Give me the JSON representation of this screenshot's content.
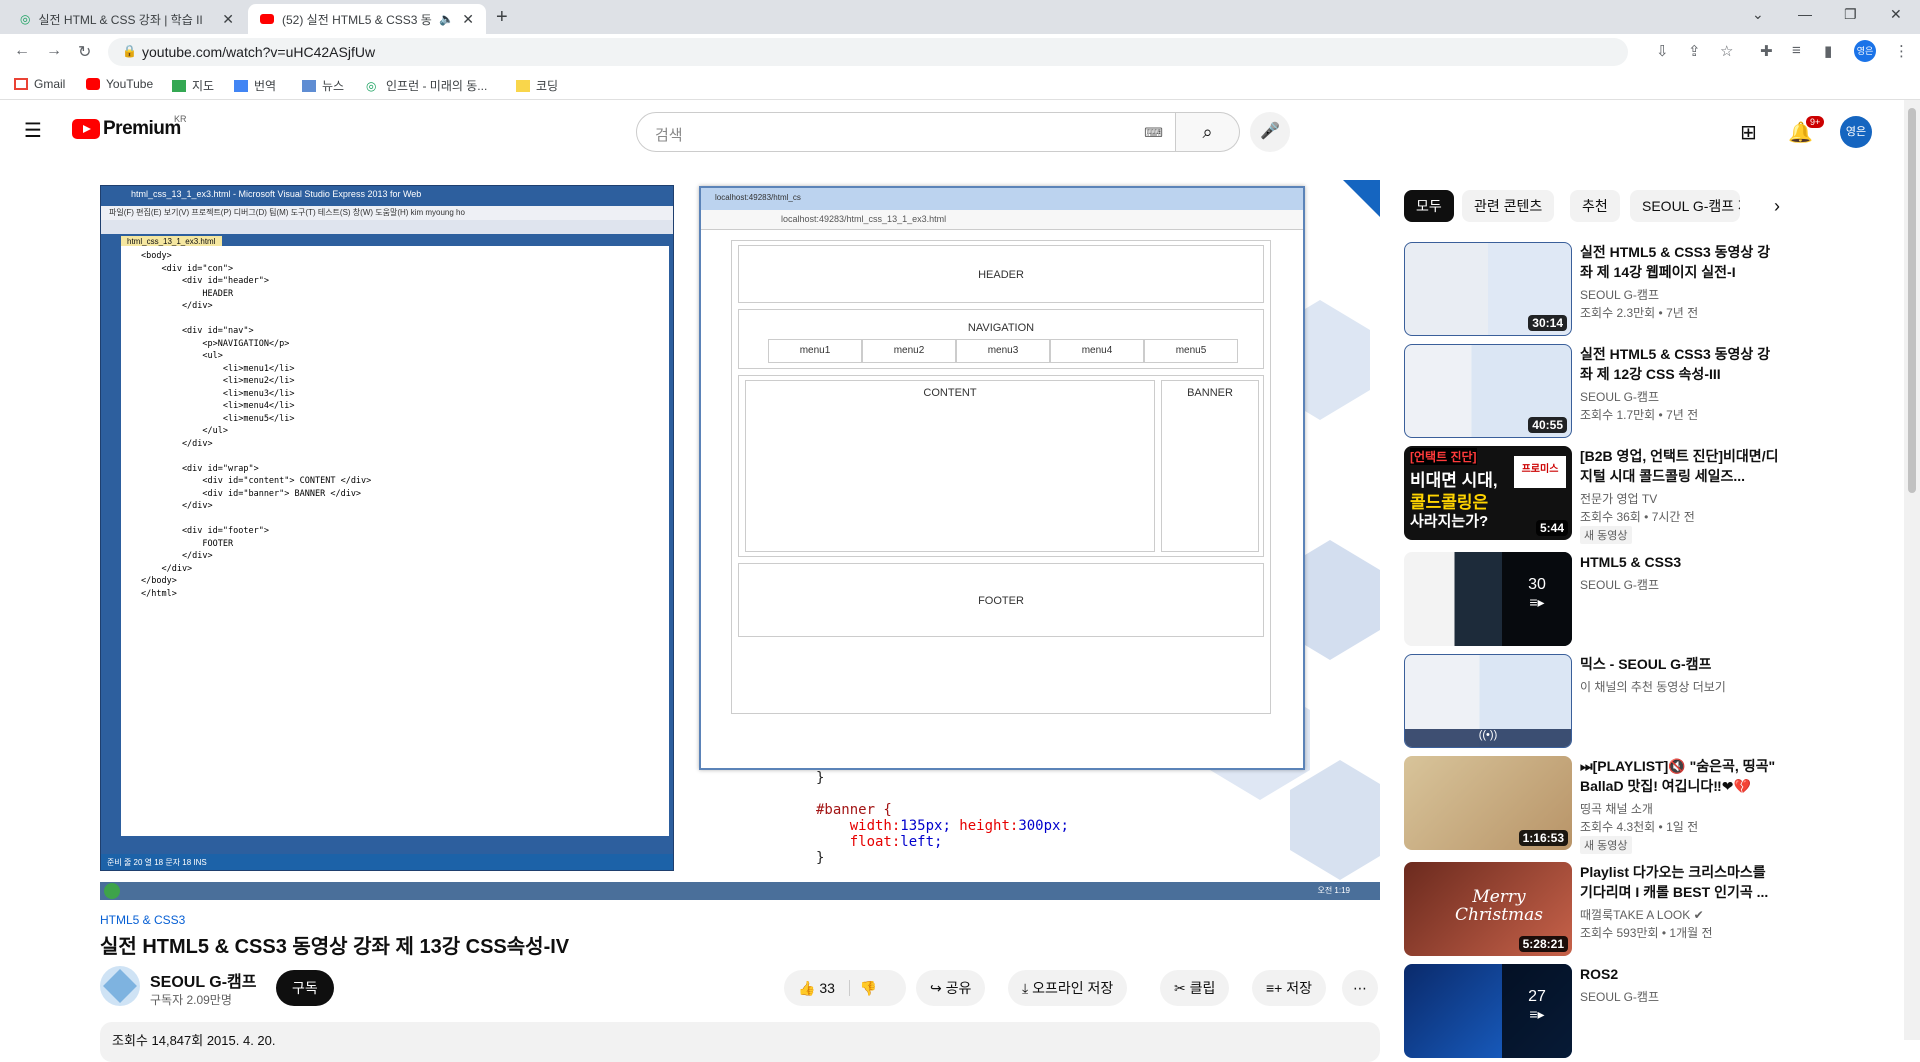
{
  "browser": {
    "tabs": [
      {
        "title": "실전 HTML & CSS 강좌 | 학습 II"
      },
      {
        "title": "(52) 실전 HTML5 & CSS3 동"
      }
    ],
    "url": "youtube.com/watch?v=uHC42ASjfUw",
    "profile_label": "영은",
    "bookmarks": [
      "Gmail",
      "YouTube",
      "지도",
      "번역",
      "뉴스",
      "인프런 - 미래의 동...",
      "코딩"
    ]
  },
  "yt": {
    "logo_text": "Premium",
    "region": "KR",
    "search_placeholder": "검색",
    "notif_badge": "9+",
    "avatar_label": "영은"
  },
  "video": {
    "vs_title": "html_css_13_1_ex3.html - Microsoft Visual Studio Express 2013 for Web",
    "vs_menu": "파일(F)   편집(E)   보기(V)   프로젝트(P)   디버그(D)   팀(M)   도구(T)   테스트(S)   창(W)   도움말(H)        kim myoung ho",
    "vs_file_tab": "html_css_13_1_ex3.html",
    "vs_status": "준비                                                                                줄 20          열 18          문자 18          INS",
    "code_lines": [
      "<body>",
      "    <div id=\"con\">",
      "        <div id=\"header\">",
      "            HEADER",
      "        </div>",
      "",
      "        <div id=\"nav\">",
      "            <p>NAVIGATION</p>",
      "            <ul>",
      "                <li>menu1</li>",
      "                <li>menu2</li>",
      "                <li>menu3</li>",
      "                <li>menu4</li>",
      "                <li>menu5</li>",
      "            </ul>",
      "        </div>",
      "",
      "        <div id=\"wrap\">",
      "            <div id=\"content\"> CONTENT </div>",
      "            <div id=\"banner\"> BANNER </div>",
      "        </div>",
      "",
      "        <div id=\"footer\">",
      "            FOOTER",
      "        </div>",
      "    </div>",
      "</body>",
      "</html>"
    ],
    "preview_tab": "localhost:49283/html_cs",
    "preview_url": "localhost:49283/html_css_13_1_ex3.html",
    "header": "HEADER",
    "navigation": "NAVIGATION",
    "menus": [
      "menu1",
      "menu2",
      "menu3",
      "menu4",
      "menu5"
    ],
    "content": "CONTENT",
    "banner": "BANNER",
    "footer": "FOOTER",
    "css_close": "}",
    "css_selector": "#banner {",
    "css_line1_prop": "width:",
    "css_line1_val": "135px;",
    "css_line1_prop2": " height:",
    "css_line1_val2": "300px;",
    "css_line2_prop": "float:",
    "css_line2_val": "left;",
    "css_end": "}",
    "taskbar_time": "오전 1:19"
  },
  "meta": {
    "playlist": "HTML5 & CSS3",
    "title": "실전 HTML5 & CSS3 동영상 강좌 제 13강 CSS속성-IV",
    "channel": "SEOUL G-캠프",
    "subscribers": "구독자 2.09만명",
    "subscribe": "구독",
    "likes": "33",
    "share": "공유",
    "offline": "오프라인 저장",
    "clip": "클립",
    "save": "저장",
    "views_date": "조회수 14,847회 2015. 4. 20."
  },
  "chips": [
    "모두",
    "관련 콘텐츠",
    "추천",
    "SEOUL G-캠프 제"
  ],
  "recommendations": [
    {
      "title": "실전 HTML5 & CSS3 동영상 강좌 제 14강 웹페이지 실전-I",
      "channel": "SEOUL G-캠프",
      "stats": "조회수 2.3만회 • 7년 전",
      "duration": "30:14"
    },
    {
      "title": "실전 HTML5 & CSS3 동영상 강좌 제 12강 CSS 속성-III",
      "channel": "SEOUL G-캠프",
      "stats": "조회수 1.7만회 • 7년 전",
      "duration": "40:55"
    },
    {
      "title": "[B2B 영업, 언택트 진단]비대면/디지털 시대 콜드콜링 세일즈...",
      "channel": "전문가 영업 TV",
      "stats": "조회수 36회 • 7시간 전",
      "badge": "새 동영상",
      "duration": "5:44",
      "thumb_text1": "[언택트 진단]",
      "thumb_text2": "비대면 시대,",
      "thumb_text3": "콜드콜링은",
      "thumb_text4": "사라지는가?",
      "thumb_logo": "프로미스"
    },
    {
      "title": "HTML5 & CSS3",
      "channel": "SEOUL G-캠프",
      "playlist_count": "30"
    },
    {
      "title": "믹스 - SEOUL G-캠프",
      "channel": "이 채널의 추천 동영상 더보기"
    },
    {
      "title": "⏭[PLAYLIST]🔇 \"숨은곡, 띵곡\" BallaD 맛집! 여깁니다‼❤💔",
      "channel": "띵곡 채널 소개",
      "stats": "조회수 4.3천회 • 1일 전",
      "badge": "새 동영상",
      "duration": "1:16:53"
    },
    {
      "title": "Playlist 다가오는 크리스마스를 기다리며 I 캐롤 BEST 인기곡 ...",
      "channel": "때껄룩TAKE A LOOK ✔",
      "stats": "조회수 593만회 • 1개월 전",
      "duration": "5:28:21",
      "thumb_text": "Merry Christmas"
    },
    {
      "title": "ROS2",
      "channel": "SEOUL G-캠프",
      "playlist_count": "27"
    }
  ]
}
